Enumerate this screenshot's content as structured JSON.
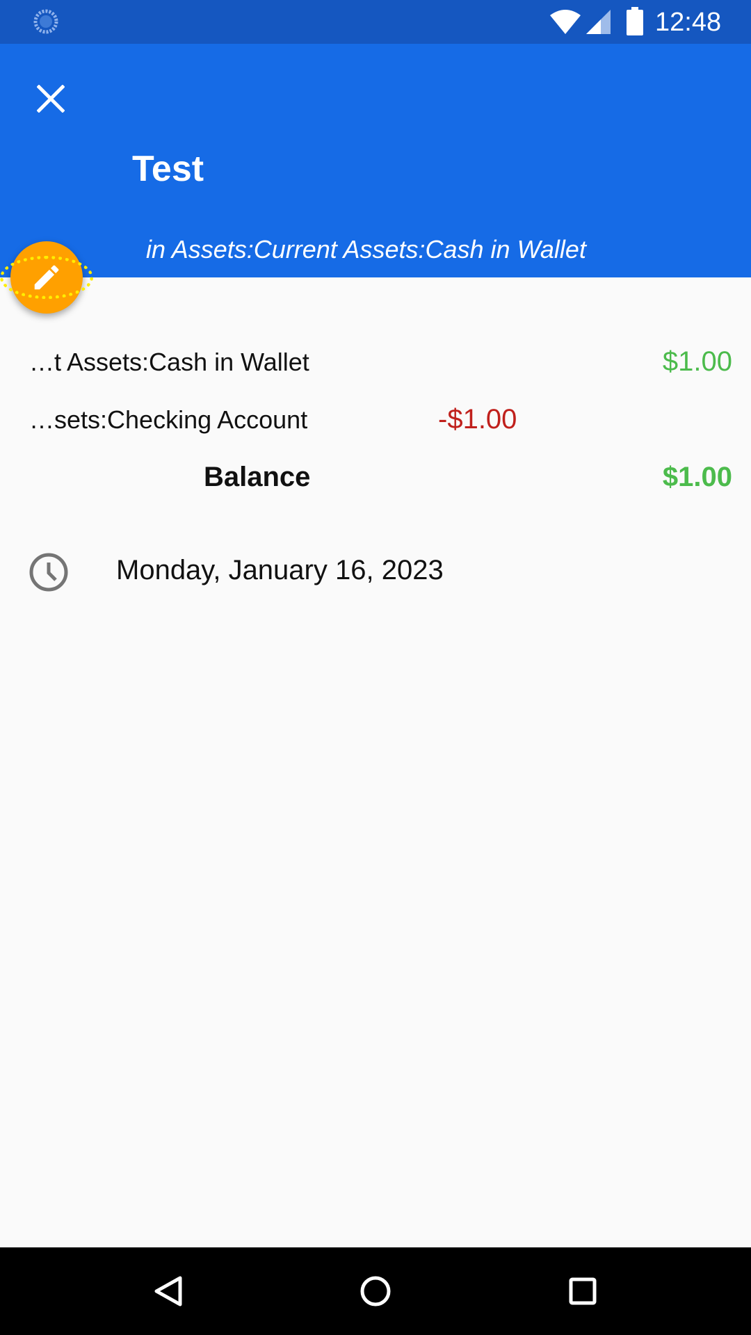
{
  "status_bar": {
    "time": "12:48",
    "icons": [
      "loading-icon",
      "wifi-icon",
      "cell-signal-icon",
      "battery-icon"
    ]
  },
  "app_bar": {
    "title": "Test",
    "subtitle": "in Assets:Current Assets:Cash in Wallet",
    "close_icon": "close-icon",
    "background_color": "#166be6"
  },
  "fab": {
    "icon": "pencil-icon",
    "color": "#ffa000"
  },
  "splits": [
    {
      "account": "…t Assets:Cash in Wallet",
      "debit": "$1.00",
      "credit": ""
    },
    {
      "account": "…sets:Checking Account",
      "debit": "",
      "credit": "-$1.00"
    }
  ],
  "balance": {
    "label": "Balance",
    "value": "$1.00"
  },
  "date": {
    "icon": "clock-icon",
    "text": "Monday, January 16, 2023"
  },
  "colors": {
    "positive": "#4cbb4c",
    "negative": "#c0201c"
  },
  "nav_bar": {
    "buttons": [
      "back-icon",
      "home-icon",
      "recents-icon"
    ]
  }
}
